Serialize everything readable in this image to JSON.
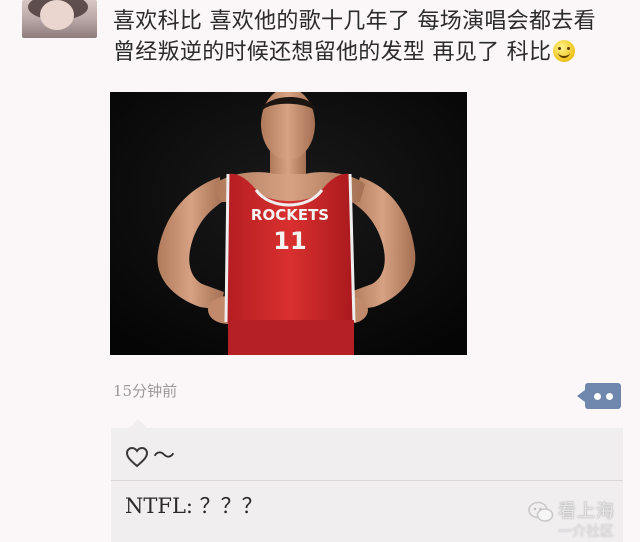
{
  "post": {
    "line1": "喜欢科比 喜欢他的歌十几年了 每场演唱会都去看",
    "line2": "曾经叛逆的时候还想留他的发型 再见了 科比",
    "emoji": "smiley-icon",
    "photo_jersey_text": "ROCKETS",
    "photo_jersey_number": "11",
    "time": "15分钟前"
  },
  "comments": {
    "likes_text": "～",
    "comment_text": "NTFL: ？？？"
  },
  "watermark": {
    "name": "看上海",
    "handle": "一介社区"
  },
  "colors": {
    "background": "#fbf7f8",
    "comment_background": "#f1eef0",
    "more_button": "#6f86ad",
    "jersey_red": "#d3262b"
  }
}
